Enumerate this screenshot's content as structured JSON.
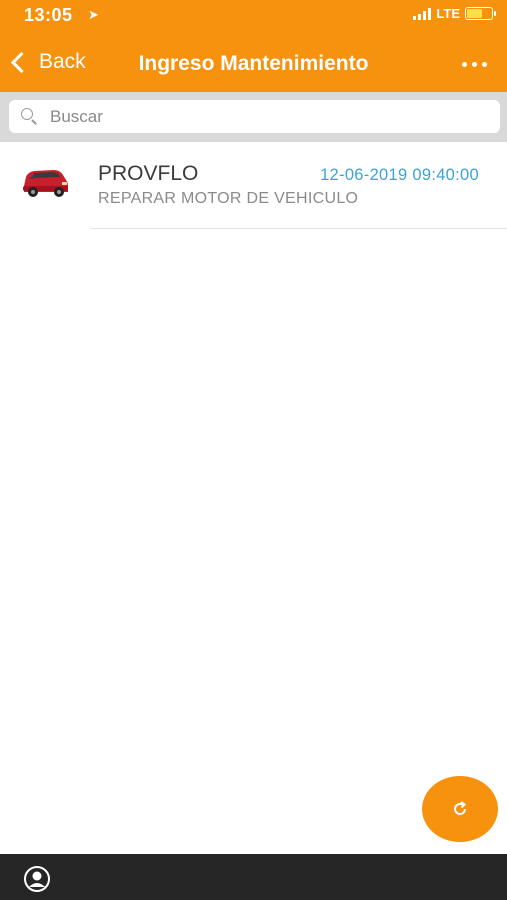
{
  "status_bar": {
    "time": "13:05",
    "location_icon": "location-arrow-icon",
    "network": "LTE",
    "battery_color": "#fde047"
  },
  "nav": {
    "back_label": "Back",
    "title": "Ingreso Mantenimiento",
    "more_icon": "more-dots-icon"
  },
  "search": {
    "placeholder": "Buscar",
    "value": ""
  },
  "list": {
    "items": [
      {
        "title": "PROVFLO",
        "date": "12-06-2019 09:40:00",
        "subtitle": "REPARAR MOTOR DE VEHICULO",
        "thumbnail_icon": "red-car-icon"
      }
    ]
  },
  "fab": {
    "icon": "refresh-icon"
  },
  "bottom_bar": {
    "icon": "user-profile-icon"
  },
  "colors": {
    "accent": "#f7920f",
    "date_text": "#3aa3d8",
    "bottom_bar": "#262626"
  }
}
